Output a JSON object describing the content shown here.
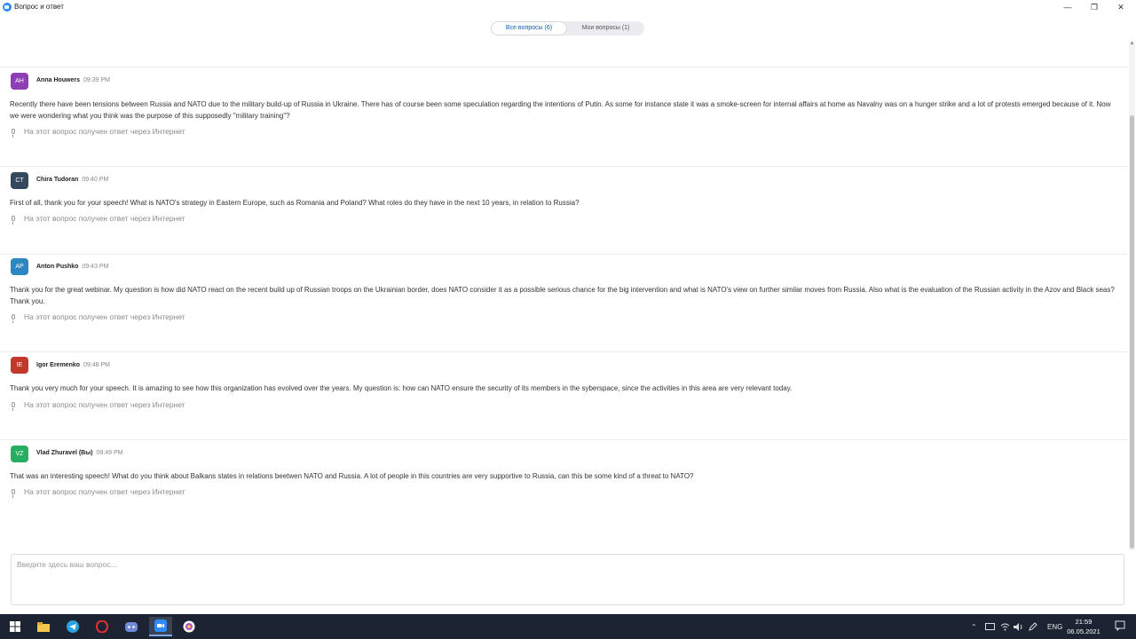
{
  "window": {
    "title": "Вопрос и ответ",
    "minimize_glyph": "—",
    "maximize_glyph": "❐",
    "close_glyph": "✕"
  },
  "tabs": [
    {
      "label": "Все вопросы (6)",
      "active": true
    },
    {
      "label": "Мои вопросы (1)",
      "active": false
    }
  ],
  "questions": [
    {
      "initials": "AH",
      "avatar_color": "#8e3fb5",
      "name": "Anna Houwers",
      "time": "09:39 PM",
      "text": "Recently there have been tensions between Russia and NATO due to the military build-up of Russia in Ukraine. There has of course been some speculation regarding the intentions of Putin. As some for instance state it was a smoke-screen for internal affairs at home as Navalny was on a hunger strike and a lot of protests emerged because of it. Now we were wondering what you think was the purpose of this supposedly \"military training\"?",
      "status": "На этот вопрос получен ответ через Интернет"
    },
    {
      "initials": "CT",
      "avatar_color": "#34495e",
      "name": "Chira Tudoran",
      "time": "09:40 PM",
      "text": "First of all, thank you for your speech! What is NATO's strategy in Eastern Europe, such as Romania and Poland? What roles do they have in the next 10 years, in relation to Russia?",
      "status": "На этот вопрос получен ответ через Интернет"
    },
    {
      "initials": "AP",
      "avatar_color": "#2e86c1",
      "name": "Anton Pushko",
      "time": "09:43 PM",
      "text": "Thank you for the great webinar. My question is how did NATO react on the recent build up of Russian troops on the Ukrainian border, does NATO consider it as a possible serious chance for the big intervention and what is NATO's view on further similar moves from Russia. Also what is the evaluation of the Russian activity in the Azov and Black seas? Thank you.",
      "status": "На этот вопрос получен ответ через Интернет"
    },
    {
      "initials": "IE",
      "avatar_color": "#c0392b",
      "name": "Igor Eremenko",
      "time": "09:48 PM",
      "text": "Thank you very much for your speech. It is amazing to see how this organization has evolved over the years. My question is: how can NATO ensure the security of its members in the syberspace, since the activities in this area are very relevant today.",
      "status": "На этот вопрос получен ответ через Интернет"
    },
    {
      "initials": "VZ",
      "avatar_color": "#27ae60",
      "name": "Vlad Zhuravel (Вы)",
      "time": "09:49 PM",
      "text": "That was an interesting speech! What do you think about Balkans states in relations beetwen NATO and Russia. A lot of people in this countries are very supportive to Russia, can this be some kind of a threat to NATO?",
      "status": "На этот вопрос получен ответ через Интернет"
    }
  ],
  "input": {
    "placeholder": "Введите здесь ваш вопрос..."
  },
  "taskbar": {
    "apps": [
      "start-icon",
      "file-explorer-icon",
      "telegram-icon",
      "opera-icon",
      "discord-icon",
      "zoom-icon",
      "unknown-app-icon"
    ],
    "language": "ENG",
    "time": "21:59",
    "date": "06.05.2021"
  }
}
